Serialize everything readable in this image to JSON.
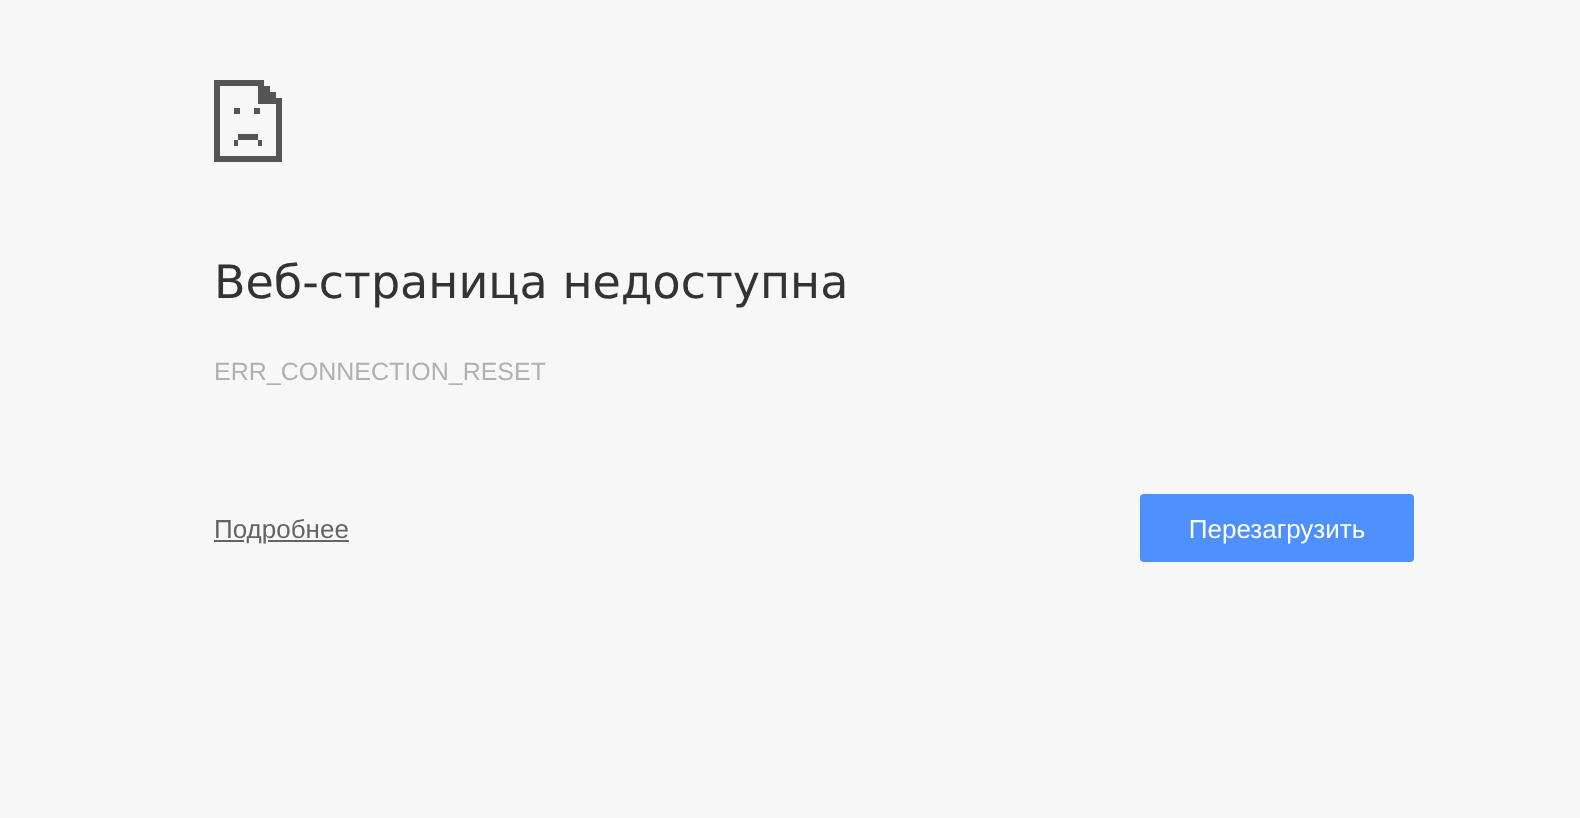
{
  "heading": "Веб-страница недоступна",
  "error_code": "ERR_CONNECTION_RESET",
  "details_link": "Подробнее",
  "reload_button": "Перезагрузить"
}
